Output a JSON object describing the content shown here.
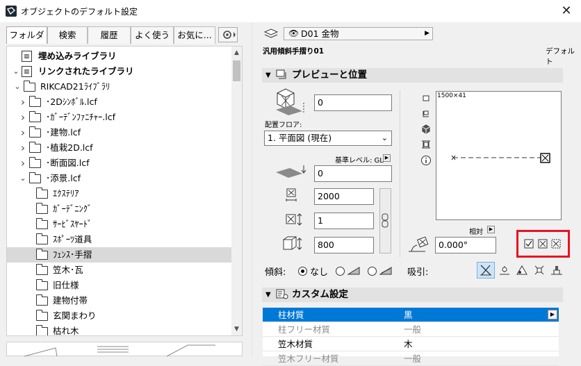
{
  "window": {
    "title": "オブジェクトのデフォルト設定"
  },
  "tabs": [
    {
      "label": "フォルダ",
      "active": true
    },
    {
      "label": "検索"
    },
    {
      "label": "履歴"
    },
    {
      "label": "よく使う"
    },
    {
      "label": "お気に..."
    }
  ],
  "tree": [
    {
      "label": "埋め込みライブラリ",
      "kind": "library",
      "indent": 0,
      "chev": "",
      "bold": true
    },
    {
      "label": "リンクされたライブラリ",
      "kind": "library",
      "indent": 0,
      "chev": "v",
      "bold": true
    },
    {
      "label": "RIKCAD21ﾗｲﾌﾞﾗﾘ",
      "kind": "folder",
      "indent": 1,
      "chev": "v"
    },
    {
      "label": "･2Dｼﾝﾎﾞﾙ.lcf",
      "kind": "folder",
      "indent": 2,
      "chev": ">"
    },
    {
      "label": "･ｶﾞｰﾃﾞﾝﾌｧﾆﾁｬｰ.lcf",
      "kind": "folder",
      "indent": 2,
      "chev": ">"
    },
    {
      "label": "･建物.lcf",
      "kind": "folder",
      "indent": 2,
      "chev": ">"
    },
    {
      "label": "･植栽2D.lcf",
      "kind": "folder",
      "indent": 2,
      "chev": ">"
    },
    {
      "label": "･断面図.lcf",
      "kind": "folder",
      "indent": 2,
      "chev": ">"
    },
    {
      "label": "･添景.lcf",
      "kind": "folder",
      "indent": 2,
      "chev": "v"
    },
    {
      "label": "ｴｸｽﾃﾘｱ",
      "kind": "folder",
      "indent": 3,
      "chev": ""
    },
    {
      "label": "ｶﾞｰﾃﾞﾆﾝｸﾞ",
      "kind": "folder",
      "indent": 3,
      "chev": ""
    },
    {
      "label": "ｻｰﾋﾞｽﾔｰﾄﾞ",
      "kind": "folder",
      "indent": 3,
      "chev": ""
    },
    {
      "label": "ｽﾎﾟｰﾂ道具",
      "kind": "folder",
      "indent": 3,
      "chev": ""
    },
    {
      "label": "ﾌｪﾝｽ･手摺",
      "kind": "folder",
      "indent": 3,
      "chev": "",
      "selected": true
    },
    {
      "label": "笠木･瓦",
      "kind": "folder",
      "indent": 3,
      "chev": ""
    },
    {
      "label": "旧仕様",
      "kind": "folder",
      "indent": 3,
      "chev": ""
    },
    {
      "label": "建物付帯",
      "kind": "folder",
      "indent": 3,
      "chev": ""
    },
    {
      "label": "玄関まわり",
      "kind": "folder",
      "indent": 3,
      "chev": ""
    },
    {
      "label": "枯れ木",
      "kind": "folder",
      "indent": 3,
      "chev": ""
    }
  ],
  "header": {
    "layer": "D01 金物",
    "object_name": "汎用傾斜手摺り01",
    "default_label": "デフォルト"
  },
  "preview_section": {
    "title": "プレビューと位置",
    "height_value": "0",
    "floor_label": "配置フロア:",
    "floor_value": "1. 平面図 (現在)",
    "ref_level_label": "基準レベル: GL",
    "elev_value": "0",
    "x_size": "2000",
    "y_size": "1",
    "z_size": "800",
    "preview_caption": "1500×41",
    "relative_label": "相対",
    "angle_value": "0.000°",
    "slope_label": "傾斜:",
    "slope_none": "なし",
    "snap_label": "吸引:"
  },
  "custom_section": {
    "title": "カスタム設定",
    "rows": [
      {
        "name": "柱材質",
        "value": "黒",
        "selected": true
      },
      {
        "name": "柱フリー材質",
        "value": "一般",
        "dim": true
      },
      {
        "name": "笠木材質",
        "value": "木"
      },
      {
        "name": "笠木フリー材質",
        "value": "一般",
        "dim": true
      }
    ]
  }
}
